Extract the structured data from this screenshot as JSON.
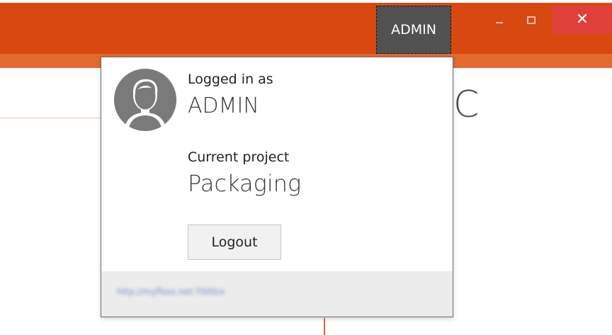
{
  "titlebar": {
    "user_button_label": "ADMIN",
    "controls": {
      "minimize": "minimize",
      "maximize": "maximize",
      "close": "close"
    },
    "colors": {
      "background": "#d84810",
      "accent_strip": "#e36a2f",
      "user_button": "#515151",
      "close_button": "#e0403a"
    }
  },
  "background": {
    "partial_glyph": "C"
  },
  "popup": {
    "logged_in_label": "Logged in as",
    "user_name": "ADMIN",
    "project_label": "Current project",
    "project_name": "Packaging",
    "logout_label": "Logout",
    "footer_link": "http://myfloss.net:7000/x"
  }
}
